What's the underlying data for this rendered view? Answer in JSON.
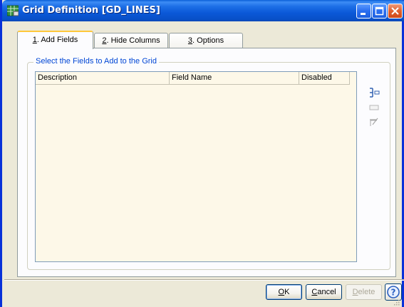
{
  "window": {
    "title": "Grid Definition  [GD_LINES]",
    "icon": "grid-app-icon"
  },
  "titlebar_buttons": [
    "minimize-icon",
    "maximize-icon",
    "close-icon"
  ],
  "tabs": [
    {
      "mnemonic": "1",
      "rest": ". Add Fields",
      "active": true
    },
    {
      "mnemonic": "2",
      "rest": ". Hide Columns",
      "active": false
    },
    {
      "mnemonic": "3",
      "rest": ". Options",
      "active": false
    }
  ],
  "group": {
    "label": "Select the Fields to Add to the Grid"
  },
  "grid": {
    "columns": [
      "Description",
      "Field Name",
      "Disabled"
    ],
    "rows": []
  },
  "side_tools": [
    "add-field-icon",
    "field-properties-icon",
    "edit-field-icon"
  ],
  "buttons": {
    "ok": {
      "mnemonic": "O",
      "rest": "K"
    },
    "cancel": {
      "mnemonic": "C",
      "rest": "ancel"
    },
    "delete": {
      "mnemonic": "D",
      "rest": "elete",
      "enabled": false
    },
    "help_icon": "help-icon"
  },
  "colors": {
    "titlebar": "#0a58d8",
    "grid_background": "#fdf8e8",
    "group_label": "#0046d5",
    "active_tab_highlight": "#ffc83c"
  }
}
